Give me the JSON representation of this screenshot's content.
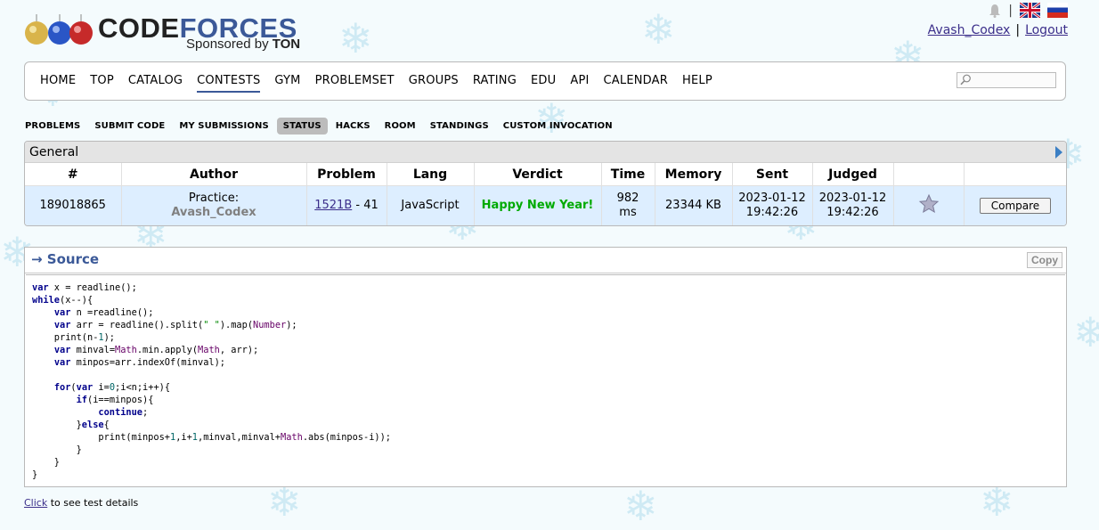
{
  "header": {
    "brand_left": "CODE",
    "brand_right": "FORCES",
    "sponsor_text": "Sponsored by",
    "sponsor_name": "TON",
    "separator": "|",
    "user": "Avash_Codex",
    "logout": "Logout"
  },
  "main_menu": [
    "HOME",
    "TOP",
    "CATALOG",
    "CONTESTS",
    "GYM",
    "PROBLEMSET",
    "GROUPS",
    "RATING",
    "EDU",
    "API",
    "CALENDAR",
    "HELP"
  ],
  "main_menu_active": "CONTESTS",
  "sub_menu": [
    "PROBLEMS",
    "SUBMIT CODE",
    "MY SUBMISSIONS",
    "STATUS",
    "HACKS",
    "ROOM",
    "STANDINGS",
    "CUSTOM INVOCATION"
  ],
  "sub_menu_active": "STATUS",
  "general": {
    "caption": "General",
    "headers": [
      "#",
      "Author",
      "Problem",
      "Lang",
      "Verdict",
      "Time",
      "Memory",
      "Sent",
      "Judged",
      "",
      ""
    ],
    "row": {
      "id": "189018865",
      "author_prefix": "Practice:",
      "author": "Avash_Codex",
      "problem_link": "1521B",
      "problem_suffix": " - 41",
      "lang": "JavaScript",
      "verdict": "Happy New Year!",
      "time_value": "982",
      "time_unit": "ms",
      "memory": "23344 KB",
      "sent_date": "2023-01-12",
      "sent_time": "19:42:26",
      "judged_date": "2023-01-12",
      "judged_time": "19:42:26",
      "compare": "Compare"
    }
  },
  "source": {
    "title": "→ Source",
    "copy": "Copy"
  },
  "footer": {
    "link": "Click",
    "text": " to see test details"
  },
  "colors": {
    "brand_blue": "#3b5998",
    "verdict_green": "#00aa00",
    "row_bg": "#ddeeff"
  }
}
